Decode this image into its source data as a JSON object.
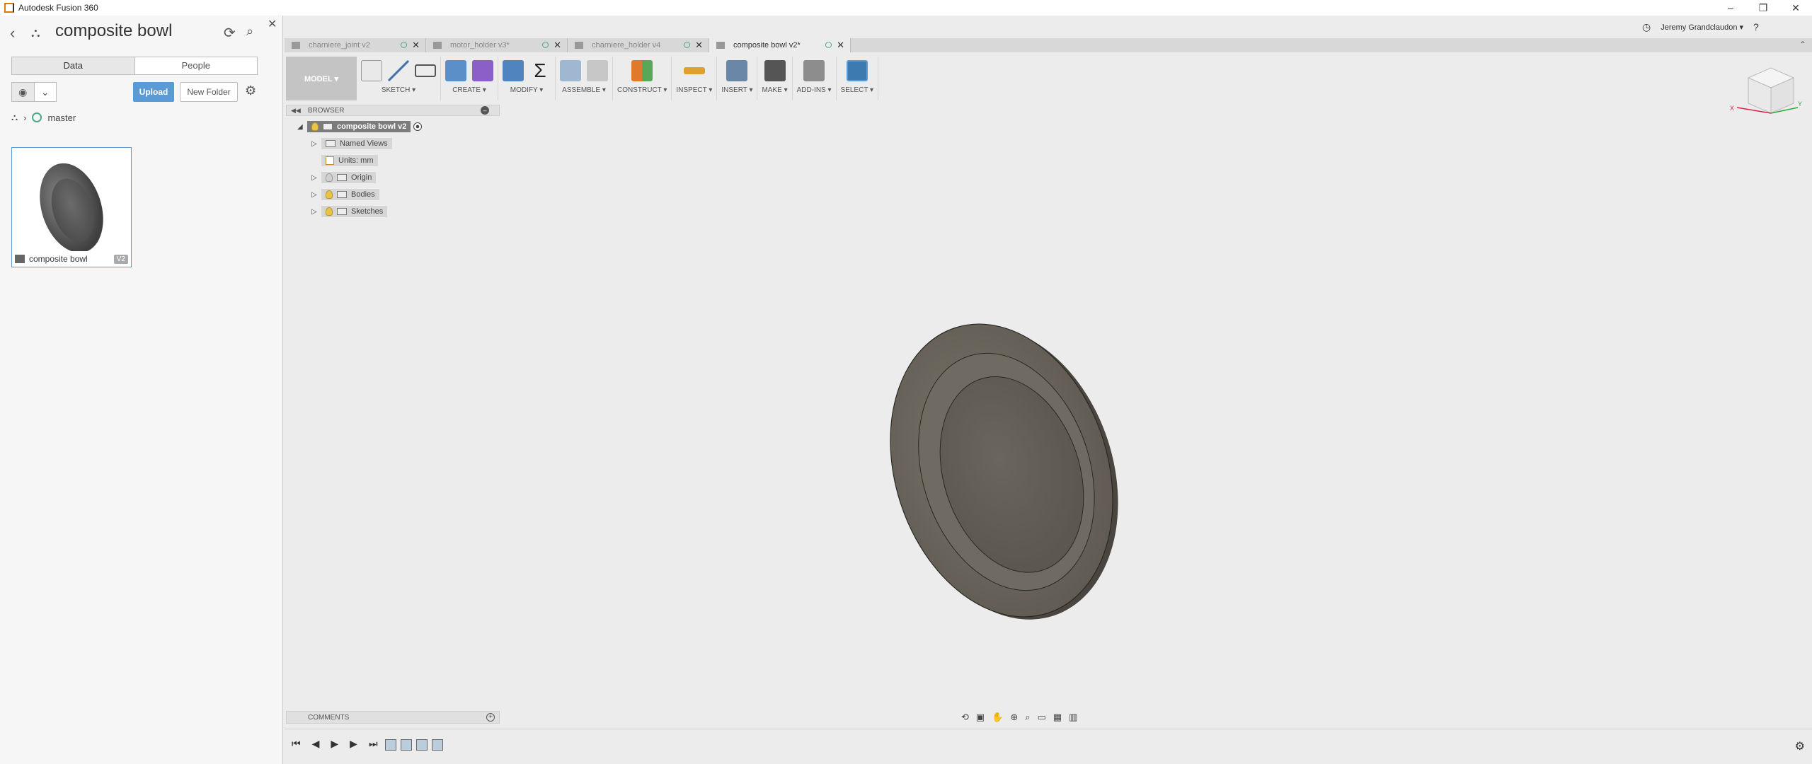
{
  "window": {
    "title": "Autodesk Fusion 360"
  },
  "data_panel": {
    "project_title": "composite bowl",
    "tabs": [
      "Data",
      "People"
    ],
    "upload_label": "Upload",
    "new_folder_label": "New Folder",
    "branch": "master",
    "file_card": {
      "name": "composite bowl",
      "version": "V2"
    }
  },
  "account": {
    "user": "Jeremy Grandclaudon ▾",
    "help": "?"
  },
  "doc_tabs": [
    {
      "label": "charniere_joint v2"
    },
    {
      "label": "motor_holder v3*"
    },
    {
      "label": "charniere_holder v4"
    },
    {
      "label": "composite bowl v2*"
    }
  ],
  "toolbar": {
    "model_label": "MODEL ▾",
    "groups": [
      {
        "label": "SKETCH ▾"
      },
      {
        "label": "CREATE ▾"
      },
      {
        "label": "MODIFY ▾"
      },
      {
        "label": "ASSEMBLE ▾"
      },
      {
        "label": "CONSTRUCT ▾"
      },
      {
        "label": "INSPECT ▾"
      },
      {
        "label": "INSERT ▾"
      },
      {
        "label": "MAKE ▾"
      },
      {
        "label": "ADD-INS ▾"
      },
      {
        "label": "SELECT ▾"
      }
    ]
  },
  "browser": {
    "header": "BROWSER",
    "root": "composite bowl v2",
    "nodes": [
      "Named Views",
      "Units: mm",
      "Origin",
      "Bodies",
      "Sketches"
    ]
  },
  "comments": {
    "header": "COMMENTS"
  },
  "colors": {
    "accent": "#5a9bd5",
    "select_active": "#3d7ab0"
  }
}
